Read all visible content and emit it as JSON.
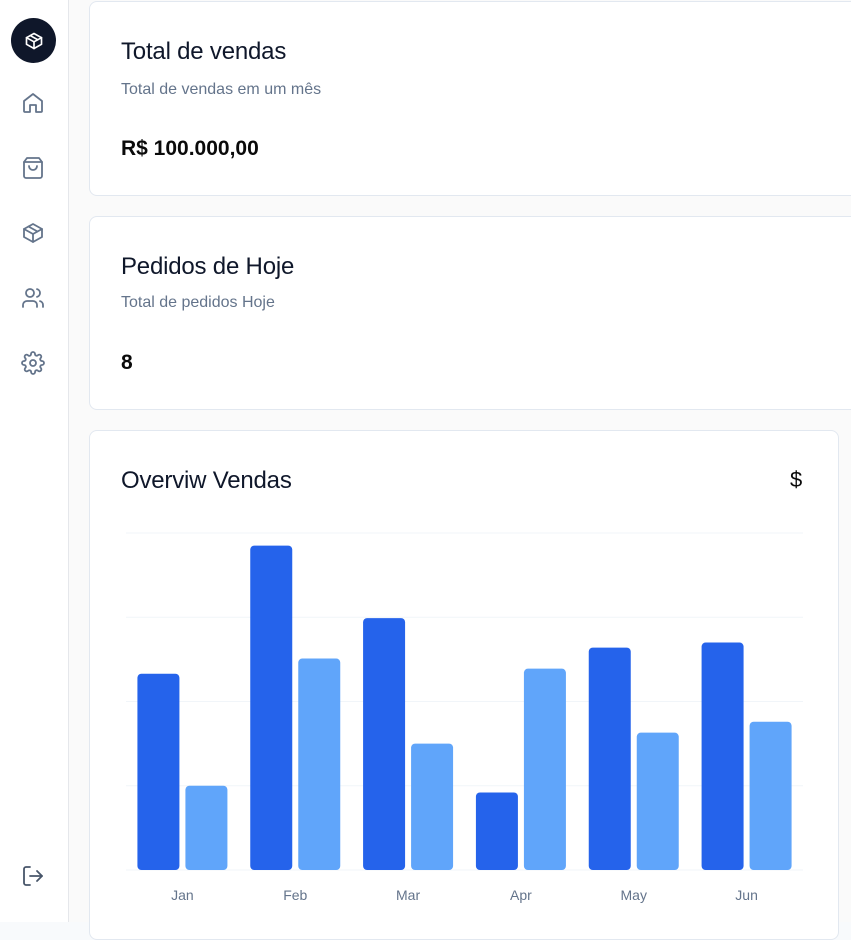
{
  "sidebar": {
    "items": [
      {
        "name": "brand",
        "icon": "package-icon"
      },
      {
        "name": "home",
        "icon": "home-icon"
      },
      {
        "name": "orders",
        "icon": "shopping-bag-icon"
      },
      {
        "name": "products",
        "icon": "package-icon"
      },
      {
        "name": "customers",
        "icon": "users-icon"
      },
      {
        "name": "settings",
        "icon": "settings-icon"
      }
    ],
    "logout_icon": "log-out-icon"
  },
  "cards": {
    "sales": {
      "title": "Total de vendas",
      "subtitle": "Total de vendas em um mês",
      "value": "R$ 100.000,00"
    },
    "orders": {
      "title": "Pedidos de Hoje",
      "subtitle": "Total de pedidos Hoje",
      "value": "8"
    },
    "overview": {
      "title": "Overviw Vendas",
      "icon": "$"
    }
  },
  "colors": {
    "series_dark": "#2563eb",
    "series_light": "#60a5fa",
    "brand_bg": "#0f172a"
  },
  "chart_data": {
    "type": "bar",
    "categories": [
      "Jan",
      "Feb",
      "Mar",
      "Apr",
      "May",
      "Jun"
    ],
    "series": [
      {
        "values": [
          233,
          385,
          299,
          92,
          264,
          270
        ]
      },
      {
        "values": [
          100,
          251,
          150,
          239,
          163,
          176
        ]
      }
    ],
    "ylim": [
      0,
      400
    ],
    "grid": true,
    "legend": "none"
  }
}
